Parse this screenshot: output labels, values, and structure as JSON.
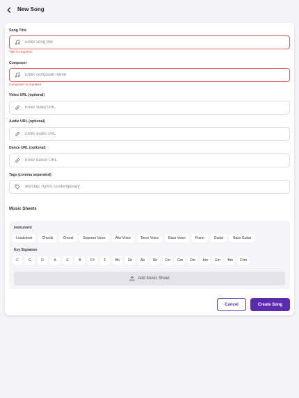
{
  "header": {
    "title": "New Song",
    "back_icon": "chevron-left-icon"
  },
  "form": {
    "song_title": {
      "label": "Song Title",
      "placeholder": "Enter song title",
      "error": "Title is required",
      "icon": "music-note-icon"
    },
    "composer": {
      "label": "Composer",
      "placeholder": "Enter composer name",
      "error": "Composer is required",
      "icon": "music-note-icon"
    },
    "video_url": {
      "label": "Video URL (optional)",
      "placeholder": "Enter video URL",
      "icon": "link-icon"
    },
    "audio_url": {
      "label": "Audio URL (optional)",
      "placeholder": "Enter audio URL",
      "icon": "link-icon"
    },
    "dance_url": {
      "label": "Dance URL (optional)",
      "placeholder": "Enter dance URL",
      "icon": "link-icon"
    },
    "tags": {
      "label": "Tags (comma separated)",
      "placeholder": "worship, hymn, contemporary",
      "icon": "tag-icon"
    }
  },
  "music_sheets": {
    "title": "Music Sheets",
    "instrument_label": "Instrument",
    "instruments": [
      "Leadsheet",
      "Chords",
      "Choral",
      "Soprano Voice",
      "Alto Voice",
      "Tenor Voice",
      "Bass Voice",
      "Piano",
      "Guitar",
      "Bass Guitar"
    ],
    "key_label": "Key Signature",
    "keys": [
      "C",
      "G",
      "D",
      "A",
      "E",
      "B",
      "F#",
      "F",
      "Bb",
      "Eb",
      "Ab",
      "Db",
      "Cm",
      "Gm",
      "Dm",
      "Am",
      "Em",
      "Bm",
      "F#m"
    ],
    "add_button": "Add Music Sheet"
  },
  "actions": {
    "cancel": "Cancel",
    "create": "Create Song"
  },
  "colors": {
    "accent": "#5b2bb0",
    "error": "#d9473f",
    "error_border": "#e0605e"
  }
}
